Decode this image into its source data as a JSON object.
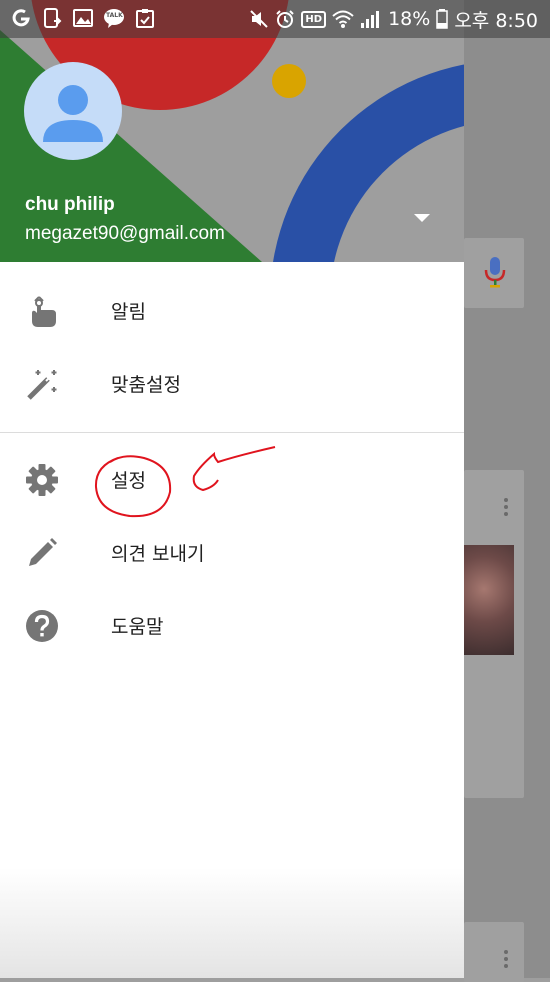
{
  "status_bar": {
    "battery": "18%",
    "time": "오후 8:50",
    "hd_label": "HD",
    "talk_label": "TALK"
  },
  "drawer": {
    "account": {
      "name": "chu philip",
      "email": "megazet90@gmail.com"
    },
    "menu": [
      {
        "label": "알림",
        "icon": "notification-hand-icon"
      },
      {
        "label": "맞춤설정",
        "icon": "magic-wand-icon"
      },
      {
        "label": "설정",
        "icon": "gear-icon"
      },
      {
        "label": "의견 보내기",
        "icon": "pencil-icon"
      },
      {
        "label": "도움말",
        "icon": "help-icon"
      }
    ]
  },
  "colors": {
    "header_green": "#2e7d32",
    "header_red": "#c62828",
    "header_blue": "#2950a6",
    "header_yellow": "#d9a400",
    "avatar_bg": "#c5dcf8",
    "avatar_fg": "#5a9cee",
    "icon_grey": "#757575",
    "annotation_red": "#e0141e"
  }
}
